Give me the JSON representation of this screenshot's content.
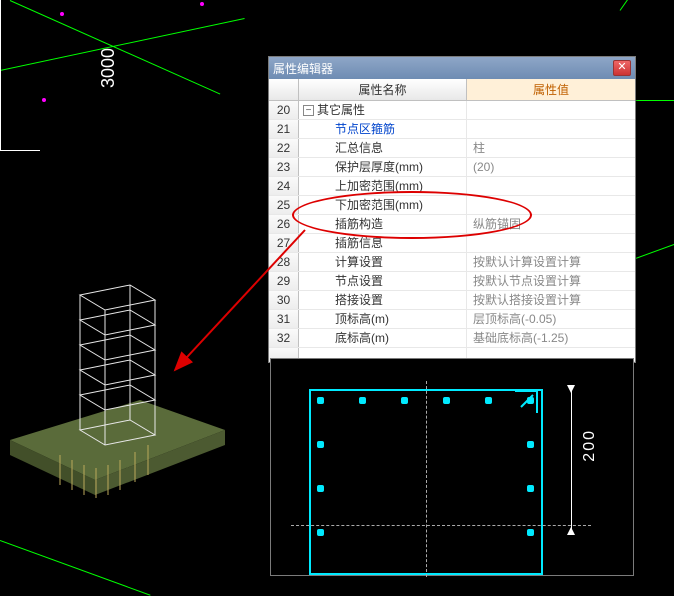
{
  "cad": {
    "dimension_left": "3000",
    "dimension_right": "200"
  },
  "dialog": {
    "title": "属性编辑器",
    "header": {
      "name_col": "属性名称",
      "value_col": "属性值"
    },
    "rows": [
      {
        "idx": "20",
        "name": "其它属性",
        "value": "",
        "group": true
      },
      {
        "idx": "21",
        "name": "节点区箍筋",
        "value": "",
        "link": true
      },
      {
        "idx": "22",
        "name": "汇总信息",
        "value": "柱"
      },
      {
        "idx": "23",
        "name": "保护层厚度(mm)",
        "value": "(20)"
      },
      {
        "idx": "24",
        "name": "上加密范围(mm)",
        "value": ""
      },
      {
        "idx": "25",
        "name": "下加密范围(mm)",
        "value": ""
      },
      {
        "idx": "26",
        "name": "插筋构造",
        "value": "纵筋锚固"
      },
      {
        "idx": "27",
        "name": "插筋信息",
        "value": ""
      },
      {
        "idx": "28",
        "name": "计算设置",
        "value": "按默认计算设置计算"
      },
      {
        "idx": "29",
        "name": "节点设置",
        "value": "按默认节点设置计算"
      },
      {
        "idx": "30",
        "name": "搭接设置",
        "value": "按默认搭接设置计算"
      },
      {
        "idx": "31",
        "name": "顶标高(m)",
        "value": "层顶标高(-0.05)"
      },
      {
        "idx": "32",
        "name": "底标高(m)",
        "value": "基础底标高(-1.25)"
      }
    ]
  }
}
